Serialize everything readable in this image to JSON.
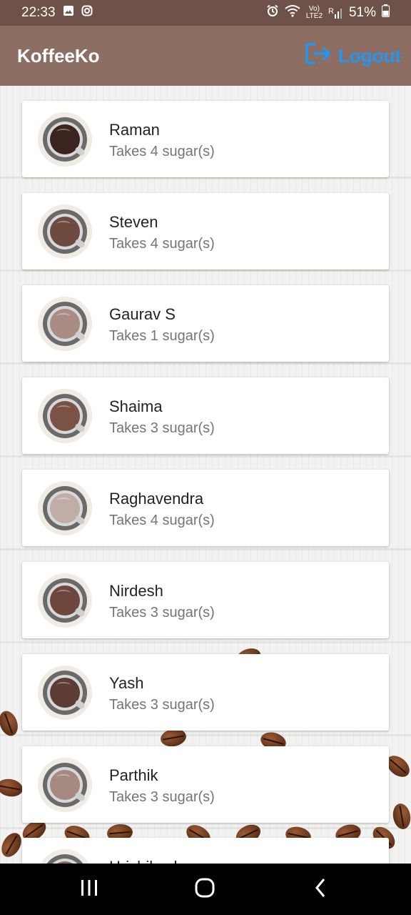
{
  "status_bar": {
    "time": "22:33",
    "network_top": "Vo)",
    "network_bottom": "LTE2",
    "signal_label": "R",
    "battery_percent": "51%"
  },
  "app_bar": {
    "title": "KoffeeKo",
    "logout_label": "Logout",
    "logout_color": "#2196f3",
    "background_color": "#8d6e63"
  },
  "users": [
    {
      "name": "Raman",
      "sugar_text": "Takes 4 sugar(s)",
      "coffee_color": "#3b2420"
    },
    {
      "name": "Steven",
      "sugar_text": "Takes 4 sugar(s)",
      "coffee_color": "#6e4a40"
    },
    {
      "name": "Gaurav S",
      "sugar_text": "Takes 1 sugar(s)",
      "coffee_color": "#a88c85"
    },
    {
      "name": "Shaima",
      "sugar_text": "Takes 3 sugar(s)",
      "coffee_color": "#7a5246"
    },
    {
      "name": "Raghavendra",
      "sugar_text": "Takes 4 sugar(s)",
      "coffee_color": "#c0ada8"
    },
    {
      "name": "Nirdesh",
      "sugar_text": "Takes 3 sugar(s)",
      "coffee_color": "#6d473d"
    },
    {
      "name": "Yash",
      "sugar_text": "Takes 3 sugar(s)",
      "coffee_color": "#5c3c34"
    },
    {
      "name": "Parthik",
      "sugar_text": "Takes 3 sugar(s)",
      "coffee_color": "#a58a82"
    }
  ],
  "partial_user": {
    "name": "Hrishikesh"
  },
  "icons": {
    "logout": "logout-icon",
    "gallery": "image-icon",
    "instagram": "instagram-icon",
    "alarm": "alarm-icon",
    "wifi": "wifi-icon",
    "battery": "battery-icon",
    "nav_recents": "recents-icon",
    "nav_home": "home-icon",
    "nav_back": "back-icon"
  }
}
